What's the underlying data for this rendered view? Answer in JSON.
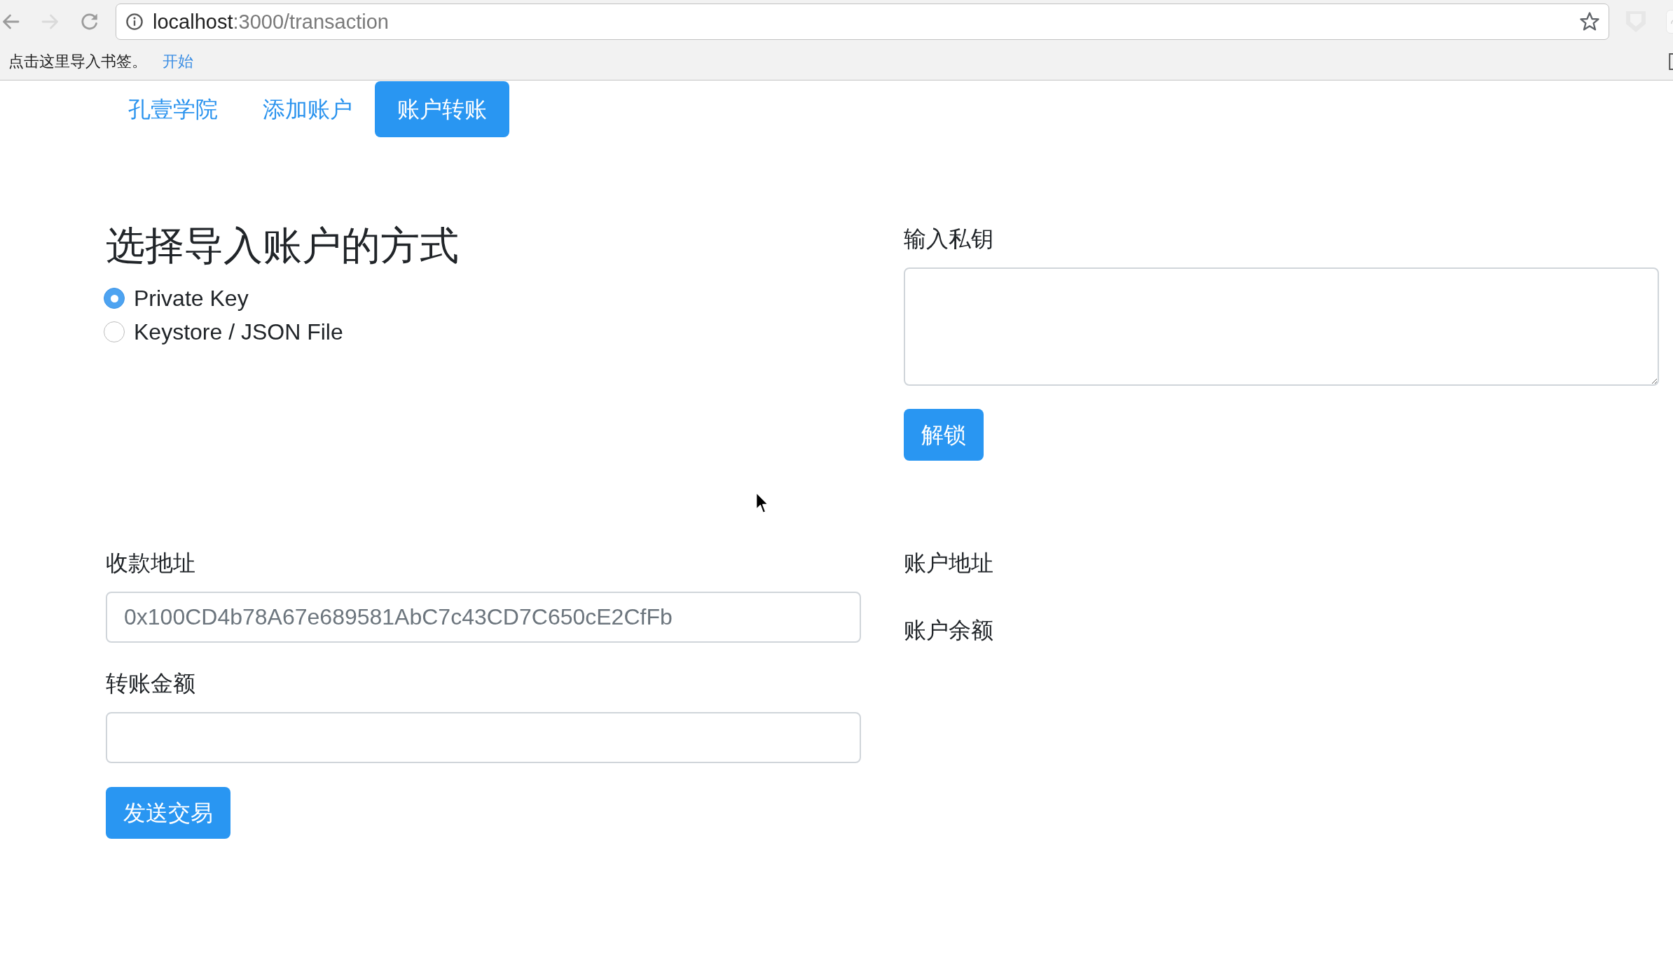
{
  "browser": {
    "nav_buttons": [
      {
        "kind": "back",
        "disabled": false
      },
      {
        "kind": "forward",
        "disabled": true
      },
      {
        "kind": "reload",
        "disabled": false
      }
    ],
    "url": {
      "host": "localhost",
      "path": ":3000/transaction"
    },
    "bookmarks_bar": {
      "hint": "点击这里导入书签。",
      "link": "开始"
    }
  },
  "nav": {
    "tabs": [
      {
        "label": "孔壹学院",
        "selected": false
      },
      {
        "label": "添加账户",
        "selected": false
      },
      {
        "label": "账户转账",
        "selected": true
      }
    ]
  },
  "import_method": {
    "title": "选择导入账户的方式",
    "options": [
      {
        "label": "Private Key",
        "selected": true
      },
      {
        "label": "Keystore / JSON File",
        "selected": false
      }
    ]
  },
  "private_key": {
    "label": "输入私钥",
    "button": "解锁"
  },
  "transfer": {
    "fields": [
      {
        "label": "收款地址",
        "placeholder": "0x100CD4b78A67e689581AbC7c43CD7C650cE2CfFb"
      },
      {
        "label": "转账金额"
      }
    ],
    "button": "发送交易"
  },
  "account": {
    "items": [
      "账户地址",
      "账户余额"
    ]
  }
}
